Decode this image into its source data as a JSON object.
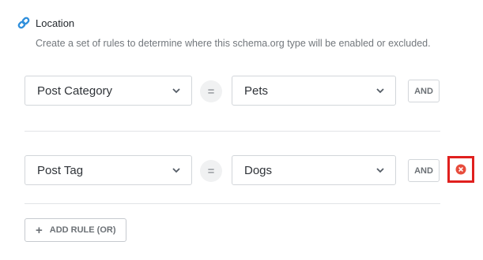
{
  "section": {
    "title": "Location",
    "description": "Create a set of rules to determine where this schema.org type will be enabled or excluded.",
    "icon": "link-icon",
    "icon_color": "#2f8fdc"
  },
  "rules": [
    {
      "param": "Post Category",
      "operator": "=",
      "value": "Pets",
      "and_label": "AND"
    },
    {
      "param": "Post Tag",
      "operator": "=",
      "value": "Dogs",
      "and_label": "AND",
      "remove_icon": "close-circle-icon",
      "remove_color": "#e74c3c",
      "highlight_color": "#e0201e"
    }
  ],
  "add_rule": {
    "label": "ADD RULE (OR)",
    "icon": "plus-icon"
  }
}
